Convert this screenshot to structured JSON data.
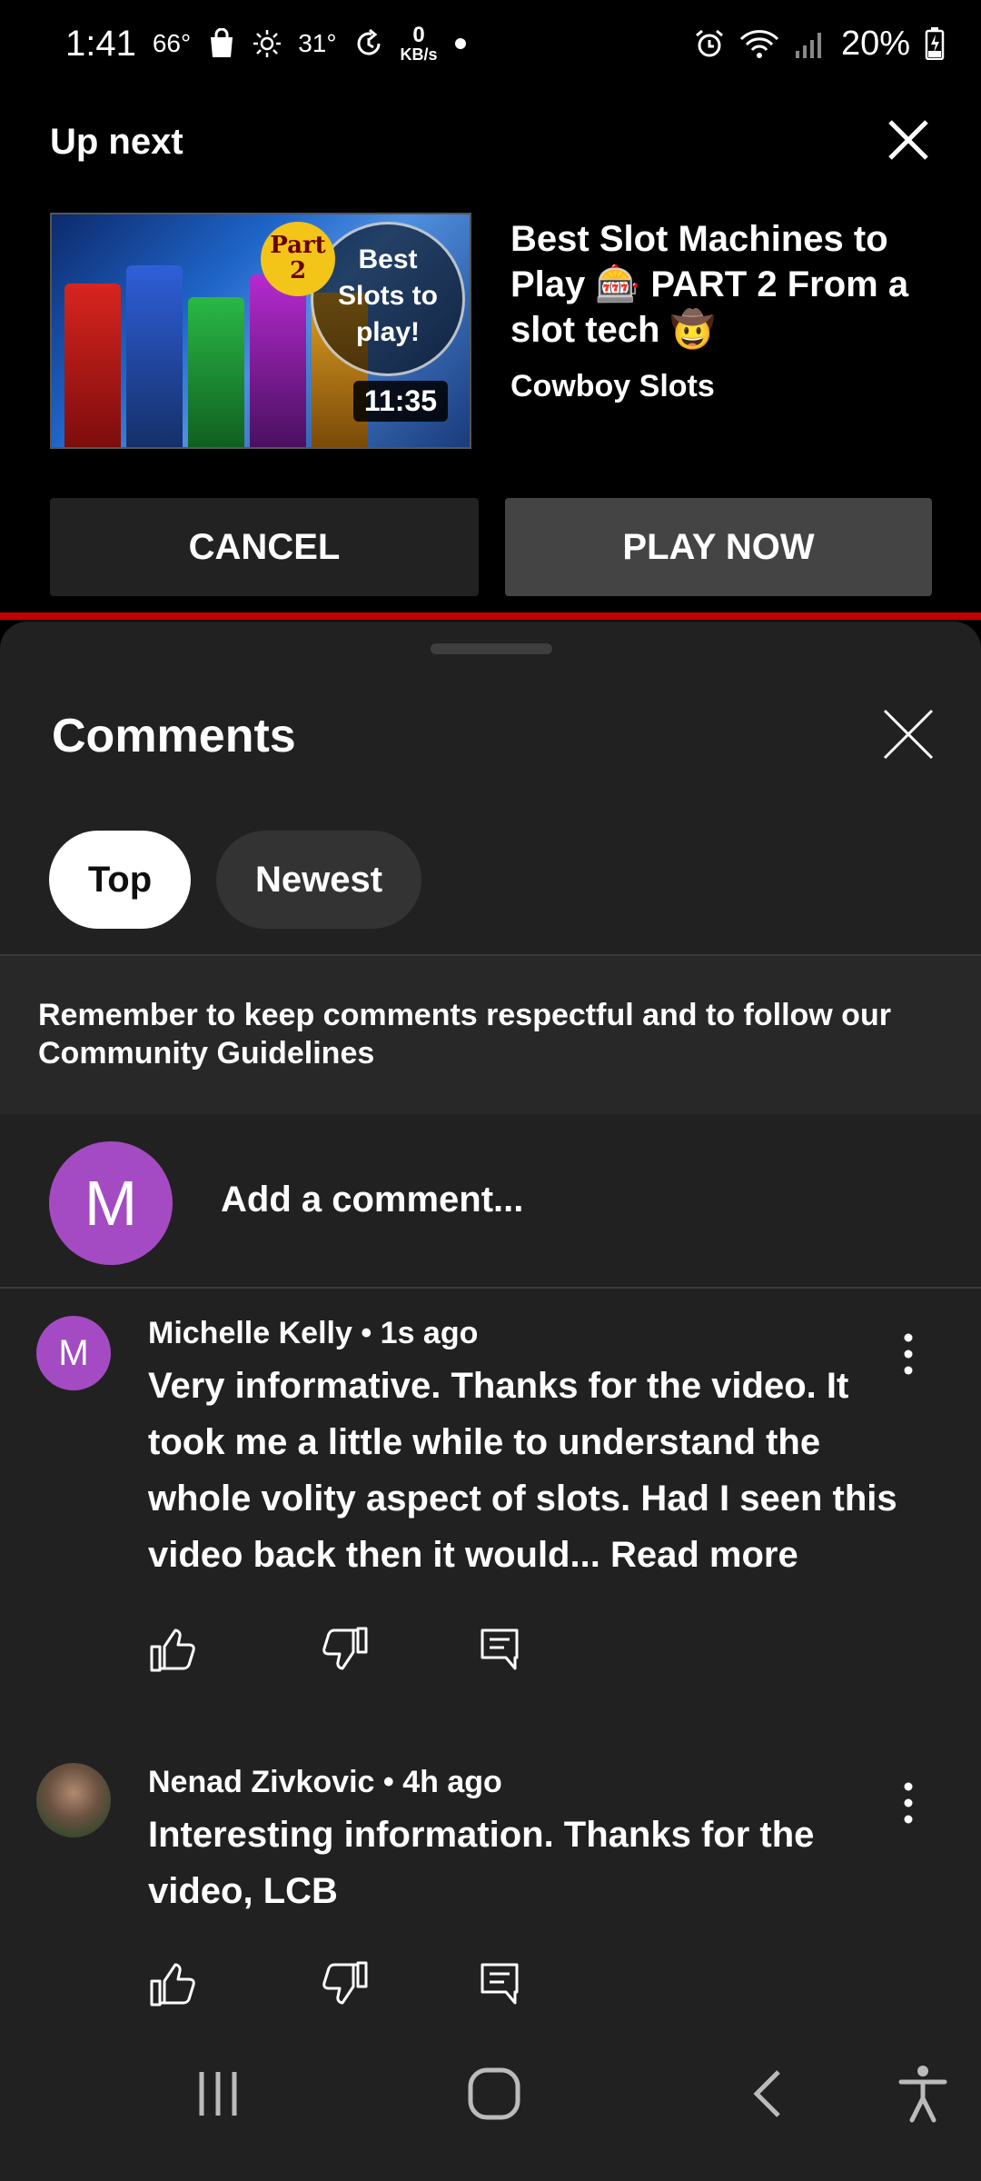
{
  "status": {
    "time": "1:41",
    "temp1": "66°",
    "temp2": "31°",
    "net_speed": "0",
    "net_unit": "KB/s",
    "battery": "20%"
  },
  "upnext": {
    "label": "Up next",
    "video_title": "Best Slot Machines to Play 🎰 PART 2 From a slot tech 🤠",
    "channel": "Cowboy Slots",
    "duration": "11:35",
    "thumb_part": "Part 2",
    "thumb_text": "Best Slots to play!",
    "cancel_label": "CANCEL",
    "play_label": "PLAY NOW"
  },
  "comments_panel": {
    "title": "Comments",
    "filters": [
      "Top",
      "Newest"
    ],
    "notice": "Remember to keep comments respectful and to follow our Community Guidelines",
    "add_placeholder": "Add a comment...",
    "user_initial": "M",
    "comments": [
      {
        "author_initial": "M",
        "meta": "Michelle Kelly • 1s ago",
        "text": "Very informative. Thanks for the video. It took me a little while to understand the whole volity  aspect of slots. Had I seen this video back then it would... Read more"
      },
      {
        "author_initial": "",
        "meta": "Nenad Zivkovic • 4h ago",
        "text": "Interesting information. Thanks for the video, LCB"
      }
    ]
  },
  "colors": {
    "accent_avatar": "#a44bc4",
    "panel_bg": "#212121",
    "progress_red": "#c40000"
  }
}
